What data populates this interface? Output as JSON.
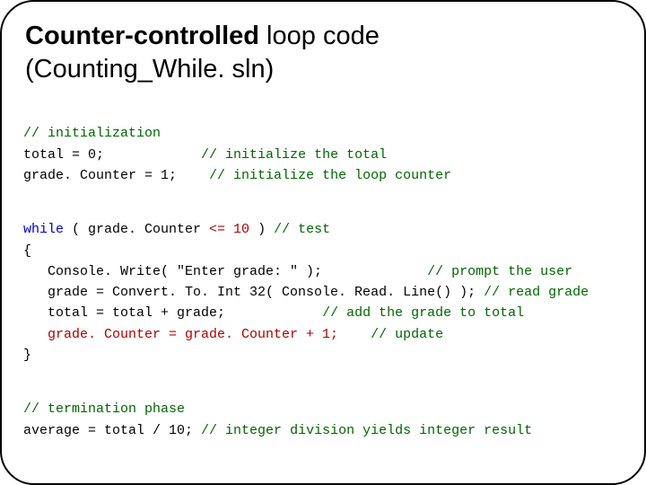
{
  "title": {
    "bold_part": "Counter-controlled",
    "after_bold": " loop code",
    "line2": "(Counting_While. sln)"
  },
  "init": {
    "c1": "// initialization",
    "l2_a": "total = 0;",
    "l2_c": "// initialize the total",
    "l3_a": "grade. Counter = 1;",
    "l3_c": "// initialize the loop counter"
  },
  "loop": {
    "l1_kw": "while",
    "l1_rest": " ( grade. Counter ",
    "l1_hl": "<= 10",
    "l1_rest2": " ) ",
    "l1_cm": "// test",
    "brace_open": "{",
    "l3_a": "   Console. Write( \"Enter grade: \" );",
    "l3_c": "// prompt the user",
    "l4_a": "   grade = Convert. To. Int 32( Console. Read. Line() ); ",
    "l4_c": "// read grade",
    "l5_a": "   total = total + grade;",
    "l5_c": "// add the grade to total",
    "l6_hl": "   grade. Counter = grade. Counter + 1;",
    "l6_c": "// update",
    "brace_close": "}"
  },
  "term": {
    "c1": "// termination phase",
    "l2_a": "average = total / 10; ",
    "l2_c": "// integer division yields integer result"
  }
}
